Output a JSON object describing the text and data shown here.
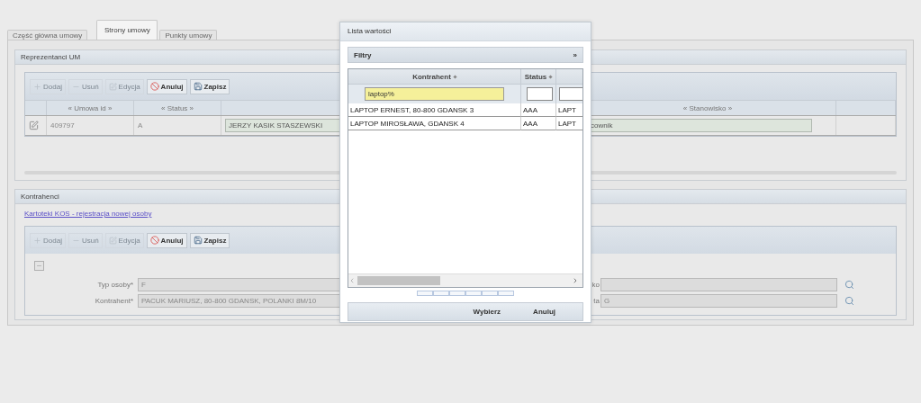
{
  "tabs": [
    {
      "label": "Część główna umowy",
      "selected": false
    },
    {
      "label": "Strony umowy",
      "selected": true
    },
    {
      "label": "Punkty umowy",
      "selected": false
    }
  ],
  "representatives": {
    "title": "Reprezentanci UM",
    "toolbar": [
      {
        "label": "Dodaj",
        "disabled": true
      },
      {
        "label": "Usuń",
        "disabled": true
      },
      {
        "label": "Edycja",
        "disabled": true
      },
      {
        "label": "Anuluj",
        "disabled": false
      },
      {
        "label": "Zapisz",
        "disabled": false
      }
    ],
    "columns": [
      "« Umowa id »",
      "« Status »"
    ],
    "columns_right": [
      "« Stanowisko »"
    ],
    "row": {
      "cells": [
        "409797",
        "A"
      ],
      "person": "JERZY KASIK STASZEWSKI",
      "position": "cownik"
    }
  },
  "contractors": {
    "title": "Kontrahenci",
    "link": "Kartoteki KOS - rejestracja nowej osoby",
    "toolbar": [
      {
        "label": "Dodaj",
        "disabled": true
      },
      {
        "label": "Usuń",
        "disabled": true
      },
      {
        "label": "Edycja",
        "disabled": true
      },
      {
        "label": "Anuluj",
        "disabled": false
      },
      {
        "label": "Zapisz",
        "disabled": false
      }
    ],
    "fields_left": [
      {
        "label": "Typ osoby*",
        "value": "F"
      },
      {
        "label": "Kontrahent*",
        "value": "PACUK MARIUSZ, 80-800 GDANSK, POLANKI 8M/10"
      }
    ],
    "fields_right": [
      {
        "label": "ko"
      },
      {
        "label": "ta",
        "value": "G"
      }
    ]
  },
  "dialog": {
    "title": "Lista wartości",
    "filters": "Filtry",
    "filters_toggle": "»",
    "columns": [
      "Kontrahent",
      "Status"
    ],
    "filter_value": "laptop%",
    "rows": [
      {
        "cells": [
          "LAPTOP ERNEST, 80-800 GDANSK 3",
          "AAA",
          "LAPT"
        ]
      },
      {
        "cells": [
          "LAPTOP MIROSŁAWA, GDANSK 4",
          "AAA",
          "LAPT"
        ]
      }
    ],
    "buttons": [
      "Wybierz",
      "Anuluj"
    ]
  }
}
